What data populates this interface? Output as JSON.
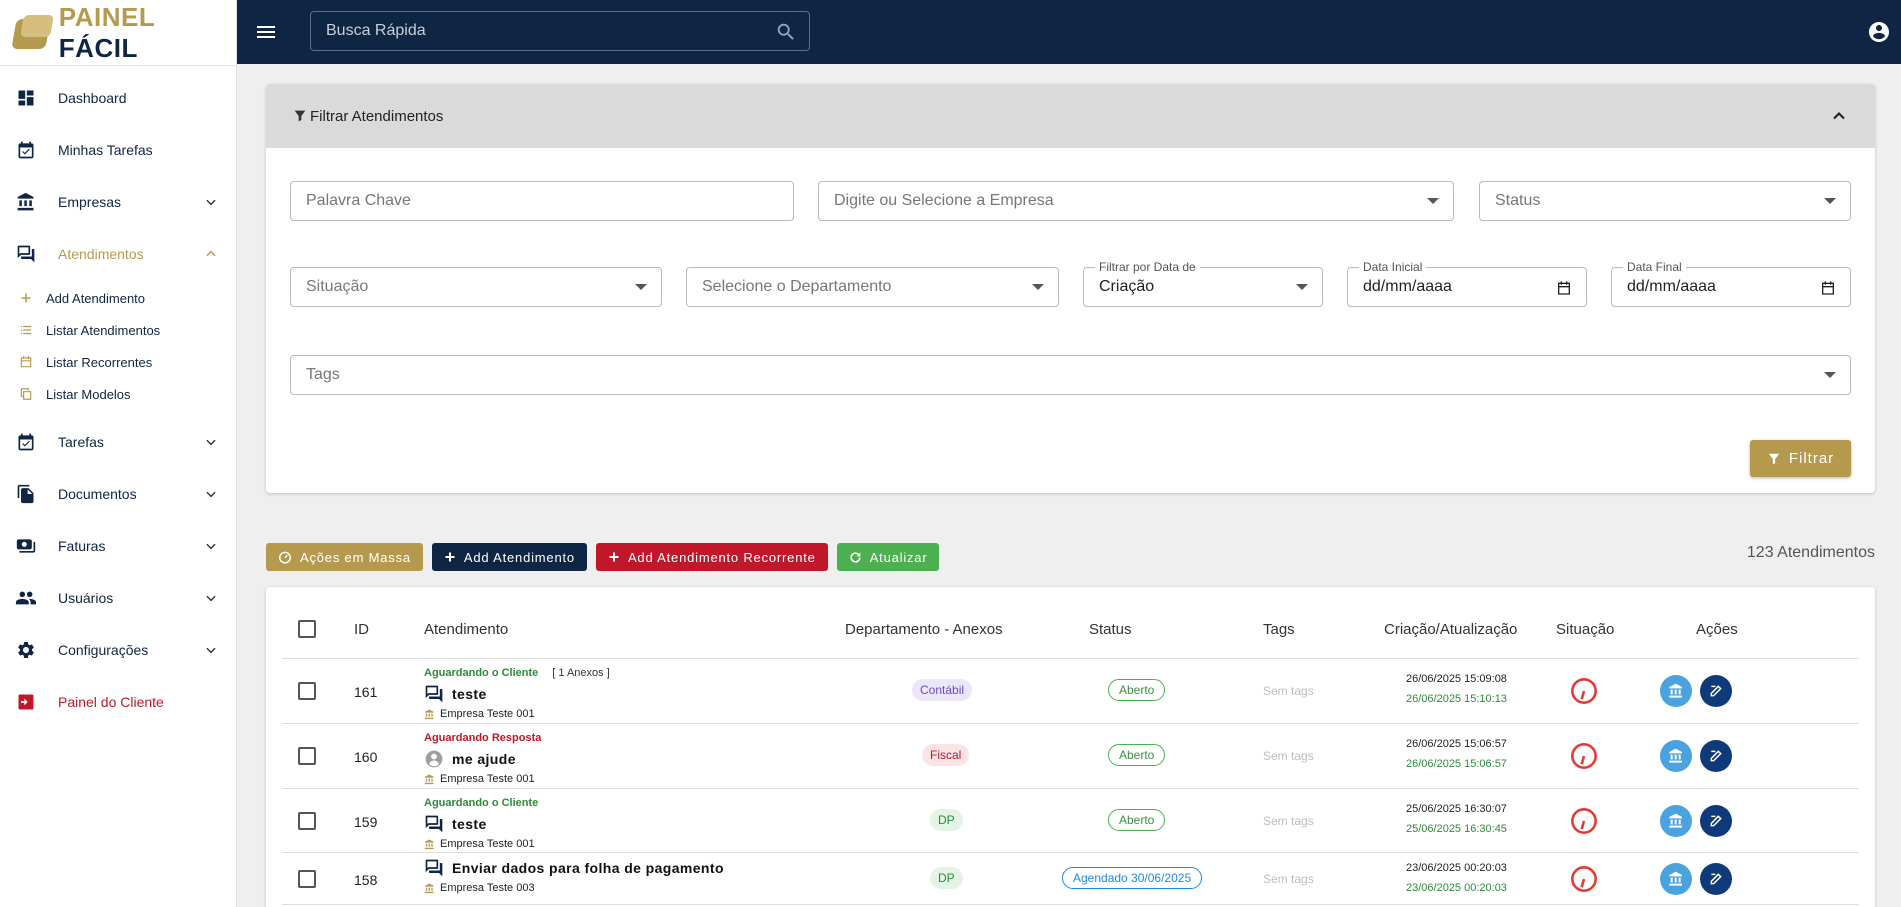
{
  "brand": {
    "part1": "PAINEL",
    "part2": "FÁCIL"
  },
  "search": {
    "placeholder": "Busca Rápida"
  },
  "sidebar": {
    "items": [
      {
        "label": "Dashboard"
      },
      {
        "label": "Minhas Tarefas"
      },
      {
        "label": "Empresas"
      },
      {
        "label": "Atendimentos"
      },
      {
        "label": "Tarefas"
      },
      {
        "label": "Documentos"
      },
      {
        "label": "Faturas"
      },
      {
        "label": "Usuários"
      },
      {
        "label": "Configurações"
      },
      {
        "label": "Painel do Cliente"
      }
    ],
    "sub": [
      {
        "label": "Add Atendimento"
      },
      {
        "label": "Listar Atendimentos"
      },
      {
        "label": "Listar Recorrentes"
      },
      {
        "label": "Listar Modelos"
      }
    ]
  },
  "filter": {
    "title": "Filtrar Atendimentos",
    "keyword_placeholder": "Palavra Chave",
    "company_placeholder": "Digite ou Selecione a Empresa",
    "status_placeholder": "Status",
    "situacao_placeholder": "Situação",
    "department_placeholder": "Selecione o Departamento",
    "date_by_label": "Filtrar por Data de",
    "date_by_value": "Criação",
    "start_label": "Data Inicial",
    "start_value": "dd/mm/aaaa",
    "end_label": "Data Final",
    "end_value": "dd/mm/aaaa",
    "tags_placeholder": "Tags",
    "button": "Filtrar"
  },
  "actions": {
    "bulk": "Ações em Massa",
    "add": "Add Atendimento",
    "add_recurring": "Add Atendimento Recorrente",
    "refresh": "Atualizar",
    "count": "123 Atendimentos"
  },
  "table": {
    "headers": {
      "id": "ID",
      "atendimento": "Atendimento",
      "dept": "Departamento - Anexos",
      "status": "Status",
      "tags": "Tags",
      "dates": "Criação/Atualização",
      "situacao": "Situação",
      "acoes": "Ações"
    },
    "rows": [
      {
        "id": "161",
        "state": "Aguardando o Cliente",
        "anexos": "[ 1 Anexos ]",
        "title": "teste",
        "company": "Empresa Teste 001",
        "dept": "Contábil",
        "status": "Aberto",
        "tags": "Sem tags",
        "created": "26/06/2025 15:09:08",
        "updated": "26/06/2025 15:10:13"
      },
      {
        "id": "160",
        "state": "Aguardando Resposta",
        "anexos": "",
        "title": "me ajude",
        "company": "Empresa Teste 001",
        "dept": "Fiscal",
        "status": "Aberto",
        "tags": "Sem tags",
        "created": "26/06/2025 15:06:57",
        "updated": "26/06/2025 15:06:57"
      },
      {
        "id": "159",
        "state": "Aguardando o Cliente",
        "anexos": "",
        "title": "teste",
        "company": "Empresa Teste 001",
        "dept": "DP",
        "status": "Aberto",
        "tags": "Sem tags",
        "created": "25/06/2025 16:30:07",
        "updated": "25/06/2025 16:30:45"
      },
      {
        "id": "158",
        "state": "",
        "anexos": "",
        "title": "Enviar dados para folha de pagamento",
        "company": "Empresa Teste 003",
        "dept": "DP",
        "status": "Agendado 30/06/2025",
        "tags": "Sem tags",
        "created": "23/06/2025 00:20:03",
        "updated": "23/06/2025 00:20:03"
      }
    ]
  },
  "colors": {
    "navy": "#0f2544",
    "gold": "#b59a4e",
    "red": "#c0182a",
    "green": "#4caf50"
  }
}
